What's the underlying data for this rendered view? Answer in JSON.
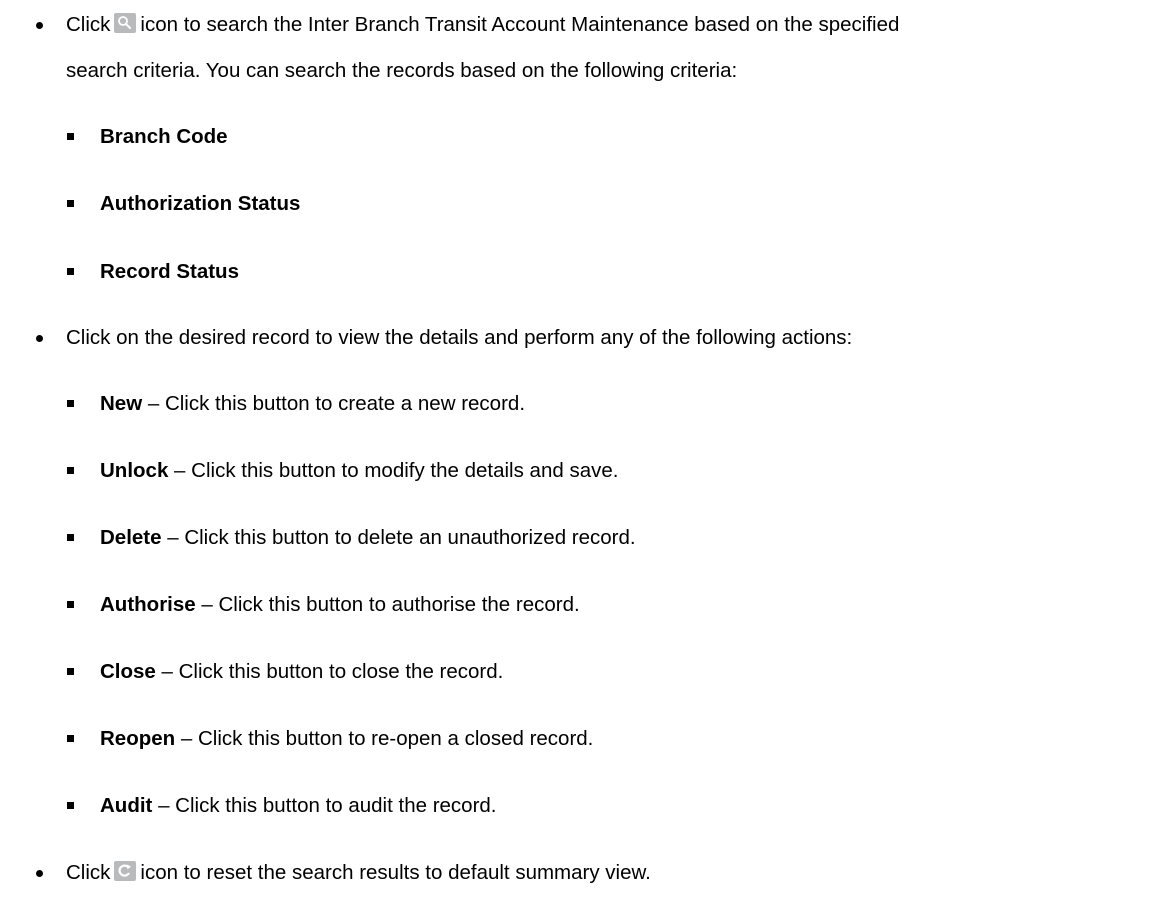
{
  "bullets": [
    {
      "pre": "Click",
      "icon": "search-icon",
      "post": "icon to search the Inter Branch Transit Account Maintenance based on the specified",
      "cont": "search criteria. You can search the records based on the following criteria:",
      "sub": [
        {
          "term": "Branch Code"
        },
        {
          "term": "Authorization Status"
        },
        {
          "term": "Record Status"
        }
      ]
    },
    {
      "text": "Click on the desired record to view the details and perform any of the following actions:",
      "sub": [
        {
          "term": "New",
          "desc": " – Click this button to create a new record."
        },
        {
          "term": "Unlock",
          "desc": " – Click this button to modify the details and save."
        },
        {
          "term": "Delete",
          "desc": " – Click this button to delete an unauthorized record."
        },
        {
          "term": "Authorise",
          "desc": " – Click this button to authorise the record."
        },
        {
          "term": "Close",
          "desc": " – Click this button to close the record."
        },
        {
          "term": "Reopen",
          "desc": " – Click this button to re-open a closed record."
        },
        {
          "term": "Audit",
          "desc": " – Click this button to audit the record."
        }
      ]
    },
    {
      "pre": "Click",
      "icon": "refresh-icon",
      "post": "icon to reset the search results to default summary view."
    }
  ]
}
